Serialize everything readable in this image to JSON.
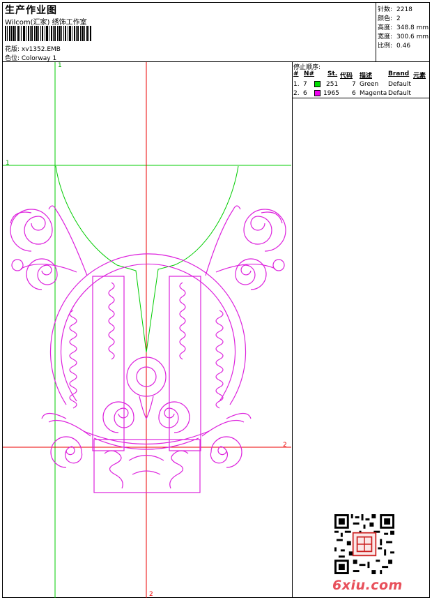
{
  "header": {
    "title": "生产作业图",
    "studio": "Wilcom(汇家) 绣饰工作室",
    "design_label": "花版:",
    "design_value": "xv1352.EMB",
    "colorway_label": "色位:",
    "colorway_value": "Colorway 1"
  },
  "stats": [
    {
      "label": "针数:",
      "value": "2218"
    },
    {
      "label": "颜色:",
      "value": "2"
    },
    {
      "label": "高度:",
      "value": "348.8 mm"
    },
    {
      "label": "宽度:",
      "value": "300.6 mm"
    },
    {
      "label": "比例:",
      "value": "0.46"
    }
  ],
  "stop_sequence": {
    "title": "停止顺序:",
    "columns": [
      "#",
      "N#",
      "St.",
      "代码",
      "描述",
      "Brand",
      "元素"
    ],
    "rows": [
      {
        "num": "1.",
        "needle": "7",
        "stitches": "251",
        "code": "7",
        "desc": "Green",
        "brand": "Default",
        "color": "#00dd00"
      },
      {
        "num": "2.",
        "needle": "6",
        "stitches": "1965",
        "code": "6",
        "desc": "Magenta",
        "brand": "Default",
        "color": "#ee00ee"
      }
    ]
  },
  "guides": {
    "green_v": "1",
    "green_h": "1",
    "red_h": "2",
    "red_v": "2"
  },
  "colors": {
    "green_thread": "#00dd00",
    "magenta_thread": "#dd22dd",
    "red_guide": "#ee0000",
    "green_guide": "#00cc00"
  },
  "watermark": "6xiu.com"
}
